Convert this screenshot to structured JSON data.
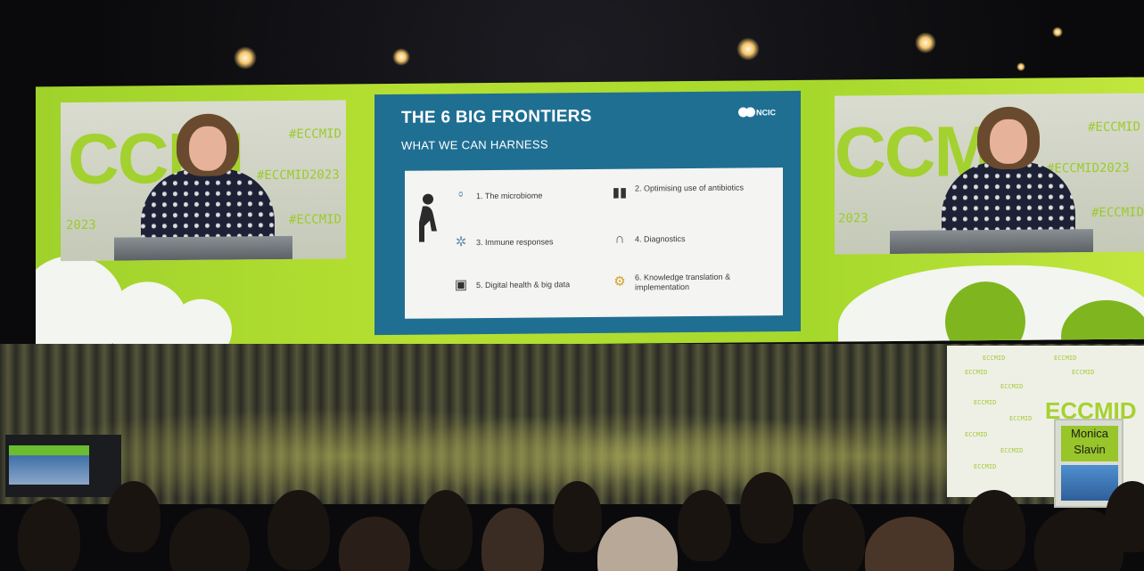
{
  "slide": {
    "title": "THE 6 BIG FRONTIERS",
    "subtitle": "WHAT WE CAN HARNESS",
    "logo_text": "NCIC",
    "items": [
      {
        "label": "1. The microbiome",
        "icon": "microbiome-icon"
      },
      {
        "label": "2. Optimising use of antibiotics",
        "icon": "antibiotics-icon"
      },
      {
        "label": "3. Immune responses",
        "icon": "immune-icon"
      },
      {
        "label": "4. Diagnostics",
        "icon": "stethoscope-icon"
      },
      {
        "label": "5. Digital health & big data",
        "icon": "computer-icon"
      },
      {
        "label": "6. Knowledge translation & implementation",
        "icon": "gears-icon"
      }
    ]
  },
  "camera_feed": {
    "logo_text": "CCMI",
    "hashtag_short": "#ECCMID",
    "hashtag_full": "#ECCMID2023",
    "year_fragment": "2023"
  },
  "stage": {
    "banner_logo": "ECCMID",
    "banner_repeat": "ECCMID",
    "lectern_name_line1": "Monica",
    "lectern_name_line2": "Slavin"
  },
  "colors": {
    "brand_green": "#a6d12f",
    "slide_blue": "#1f6f93"
  }
}
